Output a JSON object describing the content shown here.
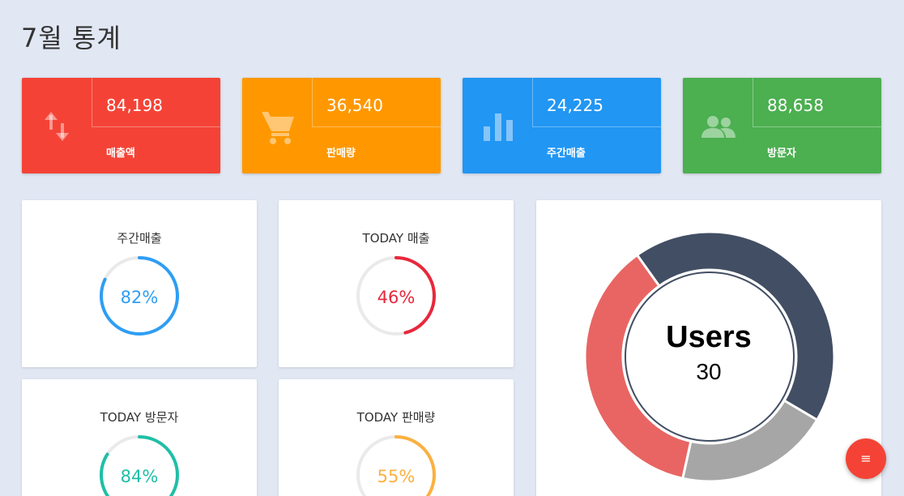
{
  "page": {
    "title": "7월 통계"
  },
  "stats": [
    {
      "value": "84,198",
      "label": "매출액",
      "icon": "swap-vertical-arrows-icon",
      "color": "#f44336"
    },
    {
      "value": "36,540",
      "label": "판매량",
      "icon": "shopping-cart-icon",
      "color": "#ff9800"
    },
    {
      "value": "24,225",
      "label": "주간매출",
      "icon": "bar-chart-icon",
      "color": "#2196f3"
    },
    {
      "value": "88,658",
      "label": "방문자",
      "icon": "people-icon",
      "color": "#4caf50"
    }
  ],
  "gauges": [
    {
      "title": "주간매출",
      "percent_text": "82%",
      "percent": 82,
      "color": "#2e9ef4"
    },
    {
      "title": "TODAY 매출",
      "percent_text": "46%",
      "percent": 46,
      "color": "#e8283c"
    },
    {
      "title": "TODAY 방문자",
      "percent_text": "84%",
      "percent": 84,
      "color": "#1fbfa6"
    },
    {
      "title": "TODAY 판매량",
      "percent_text": "55%",
      "percent": 55,
      "color": "#fbb040"
    }
  ],
  "chart_data": {
    "type": "pie",
    "center_title": "Users",
    "center_value": "30",
    "slices": [
      {
        "value": 13,
        "color": "#424e63"
      },
      {
        "value": 6,
        "color": "#a6a6a6"
      },
      {
        "value": 11,
        "color": "#e86563"
      }
    ]
  },
  "fab": {
    "icon": "menu-icon",
    "glyph": "≡"
  }
}
